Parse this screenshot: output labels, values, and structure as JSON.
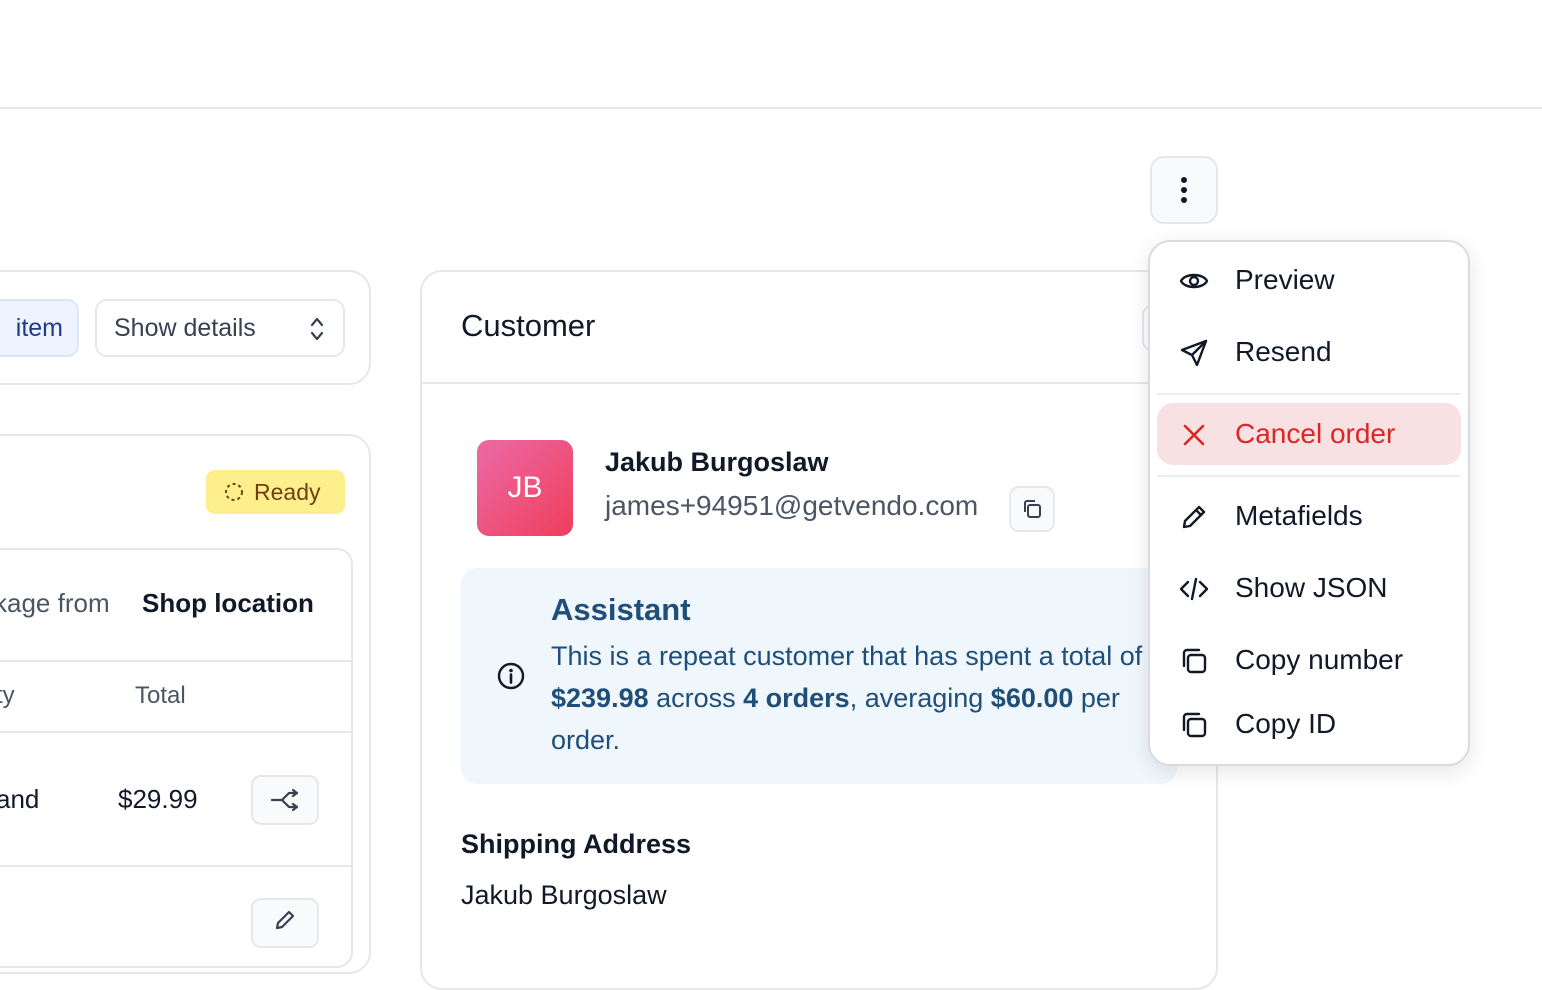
{
  "order_items": {
    "add_item_label": "item",
    "show_details_label": "Show details"
  },
  "fulfillment": {
    "status": "Ready",
    "package_prefix": "kage from",
    "location": "Shop location",
    "columns": {
      "qty": "ty",
      "total": "Total"
    },
    "rows": [
      {
        "name": "and",
        "price": "$29.99"
      }
    ]
  },
  "customer": {
    "title": "Customer",
    "initials": "JB",
    "name": "Jakub Burgoslaw",
    "email": "james+94951@getvendo.com",
    "assistant": {
      "title": "Assistant",
      "text_1": "This is a repeat customer that has spent a total of ",
      "total_spent": "$239.98",
      "text_2": " across ",
      "order_count": "4 orders",
      "text_3": ", averaging ",
      "average": "$60.00",
      "text_4": " per order."
    },
    "shipping_title": "Shipping Address",
    "shipping_name": "Jakub Burgoslaw"
  },
  "menu": {
    "items": [
      {
        "label": "Preview",
        "icon": "eye-icon"
      },
      {
        "label": "Resend",
        "icon": "send-icon"
      },
      {
        "label": "Cancel order",
        "icon": "close-icon"
      },
      {
        "label": "Metafields",
        "icon": "pencil-icon"
      },
      {
        "label": "Show JSON",
        "icon": "code-icon"
      },
      {
        "label": "Copy number",
        "icon": "copy-icon"
      },
      {
        "label": "Copy ID",
        "icon": "copy-icon"
      }
    ]
  },
  "colors": {
    "danger": "#dc2626",
    "danger_bg": "#f8e1e2",
    "assistant_bg": "#eff6fc",
    "assistant_text": "#1f4e79",
    "ready_bg": "#fcef8c"
  }
}
